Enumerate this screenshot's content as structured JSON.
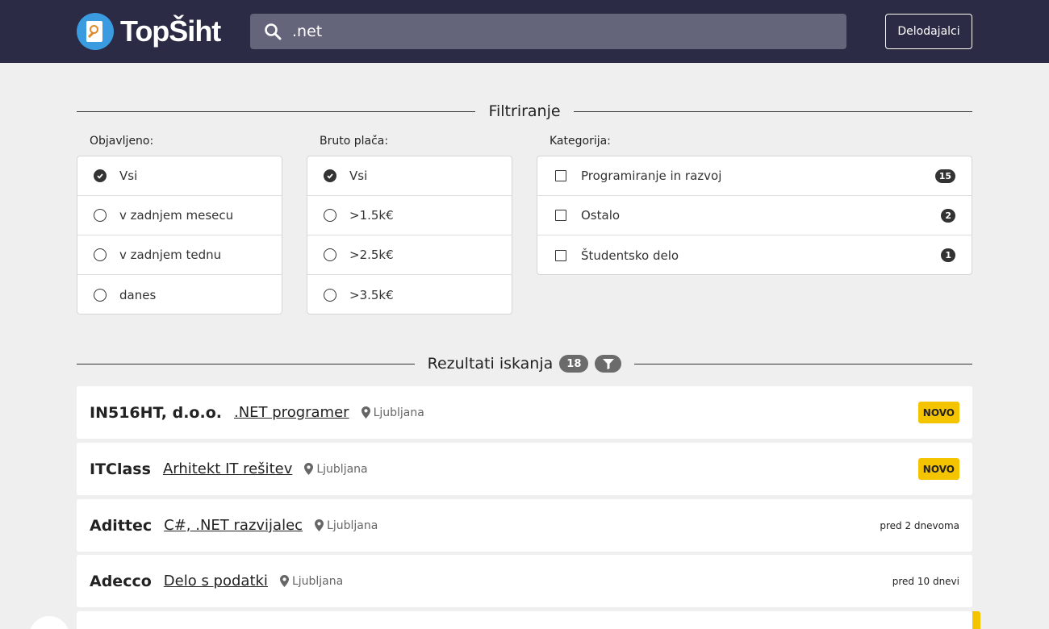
{
  "header": {
    "logo_text": "TopŠiht",
    "search_value": ".net",
    "employers_label": "Delodajalci"
  },
  "filters": {
    "title": "Filtriranje",
    "published": {
      "label": "Objavljeno:",
      "options": [
        "Vsi",
        "v zadnjem mesecu",
        "v zadnjem tednu",
        "danes"
      ],
      "selected": "Vsi"
    },
    "salary": {
      "label": "Bruto plača:",
      "options": [
        ">1.5k€",
        ">2.5k€",
        ">3.5k€"
      ],
      "all": "Vsi",
      "selected": "Vsi"
    },
    "category": {
      "label": "Kategorija:",
      "items": [
        {
          "label": "Programiranje in razvoj",
          "count": "15"
        },
        {
          "label": "Ostalo",
          "count": "2"
        },
        {
          "label": "Študentsko delo",
          "count": "1"
        }
      ]
    }
  },
  "results": {
    "title": "Rezultati iskanja",
    "count": "18",
    "items": [
      {
        "company": "IN516HT, d.o.o.",
        "title": ".NET programer",
        "location": "Ljubljana",
        "tag": "NOVO"
      },
      {
        "company": "ITClass",
        "title": "Arhitekt IT rešitev",
        "location": "Ljubljana",
        "tag": "NOVO"
      },
      {
        "company": "Adittec",
        "title": "C#, .NET razvijalec",
        "location": "Ljubljana",
        "ago": "pred 2 dnevoma"
      },
      {
        "company": "Adecco",
        "title": "Delo s podatki",
        "location": "Ljubljana",
        "ago": "pred 10 dnevi"
      }
    ]
  },
  "colors": {
    "header_bg": "#2b2b45",
    "new_badge": "#f5c400",
    "logo_blue": "#3a9be0"
  }
}
